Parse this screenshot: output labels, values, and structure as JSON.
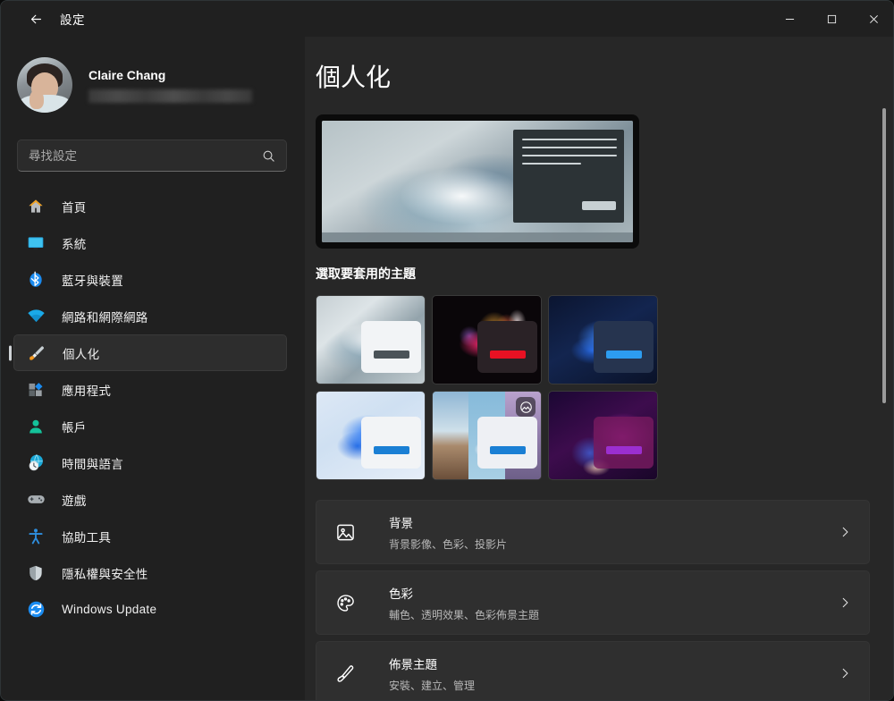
{
  "window": {
    "title": "設定",
    "back_icon": "arrow-left-icon",
    "controls": {
      "minimize": "minimize-icon",
      "maximize": "maximize-icon",
      "close": "close-icon"
    }
  },
  "profile": {
    "name": "Claire Chang",
    "email_redacted": ""
  },
  "search": {
    "placeholder": "尋找設定",
    "value": "",
    "icon": "search-icon"
  },
  "sidebar": {
    "items": [
      {
        "label": "首頁",
        "icon": "home-icon",
        "selected": false
      },
      {
        "label": "系統",
        "icon": "monitor-icon",
        "selected": false
      },
      {
        "label": "藍牙與裝置",
        "icon": "bluetooth-icon",
        "selected": false
      },
      {
        "label": "網路和網際網路",
        "icon": "wifi-icon",
        "selected": false
      },
      {
        "label": "個人化",
        "icon": "paintbrush-icon",
        "selected": true
      },
      {
        "label": "應用程式",
        "icon": "apps-icon",
        "selected": false
      },
      {
        "label": "帳戶",
        "icon": "account-icon",
        "selected": false
      },
      {
        "label": "時間與語言",
        "icon": "clock-globe-icon",
        "selected": false
      },
      {
        "label": "遊戲",
        "icon": "gamepad-icon",
        "selected": false
      },
      {
        "label": "協助工具",
        "icon": "accessibility-icon",
        "selected": false
      },
      {
        "label": "隱私權與安全性",
        "icon": "shield-icon",
        "selected": false
      },
      {
        "label": "Windows Update",
        "icon": "update-icon",
        "selected": false
      }
    ]
  },
  "main": {
    "page_title": "個人化",
    "preview": {
      "name": "desktop-preview",
      "description": "Windows 11 desktop preview with bloom wallpaper and open window"
    },
    "themes_section_title": "選取要套用的主題",
    "themes": [
      {
        "name": "theme-windows-light-bloom",
        "accent": "#4b5358",
        "selected": true
      },
      {
        "name": "theme-flow-dark",
        "accent": "#e81123",
        "selected": false
      },
      {
        "name": "theme-glow-dark",
        "accent": "#2d9cf0",
        "selected": false
      },
      {
        "name": "theme-windows-light-blue",
        "accent": "#1a7fd4",
        "selected": false
      },
      {
        "name": "theme-slideshow-nature",
        "accent": "#1a7fd4",
        "selected": false,
        "badge": "pictures-icon"
      },
      {
        "name": "theme-sunrise-dark",
        "accent": "#8a2e9e",
        "selected": false
      }
    ],
    "settings_list": [
      {
        "icon": "image-icon",
        "title": "背景",
        "subtitle": "背景影像、色彩、投影片",
        "chevron": "chevron-right-icon"
      },
      {
        "icon": "palette-icon",
        "title": "色彩",
        "subtitle": "輔色、透明效果、色彩佈景主題",
        "chevron": "chevron-right-icon"
      },
      {
        "icon": "brush-icon",
        "title": "佈景主題",
        "subtitle": "安裝、建立、管理",
        "chevron": "chevron-right-icon"
      }
    ]
  },
  "scrollbar": {
    "name": "vertical-scrollbar"
  },
  "colors": {
    "window_bg": "#202020",
    "content_bg": "#272727",
    "card_bg": "#2f2f2f",
    "accent_text": "#ffffff",
    "subtitle_text": "#b8b8b8"
  }
}
